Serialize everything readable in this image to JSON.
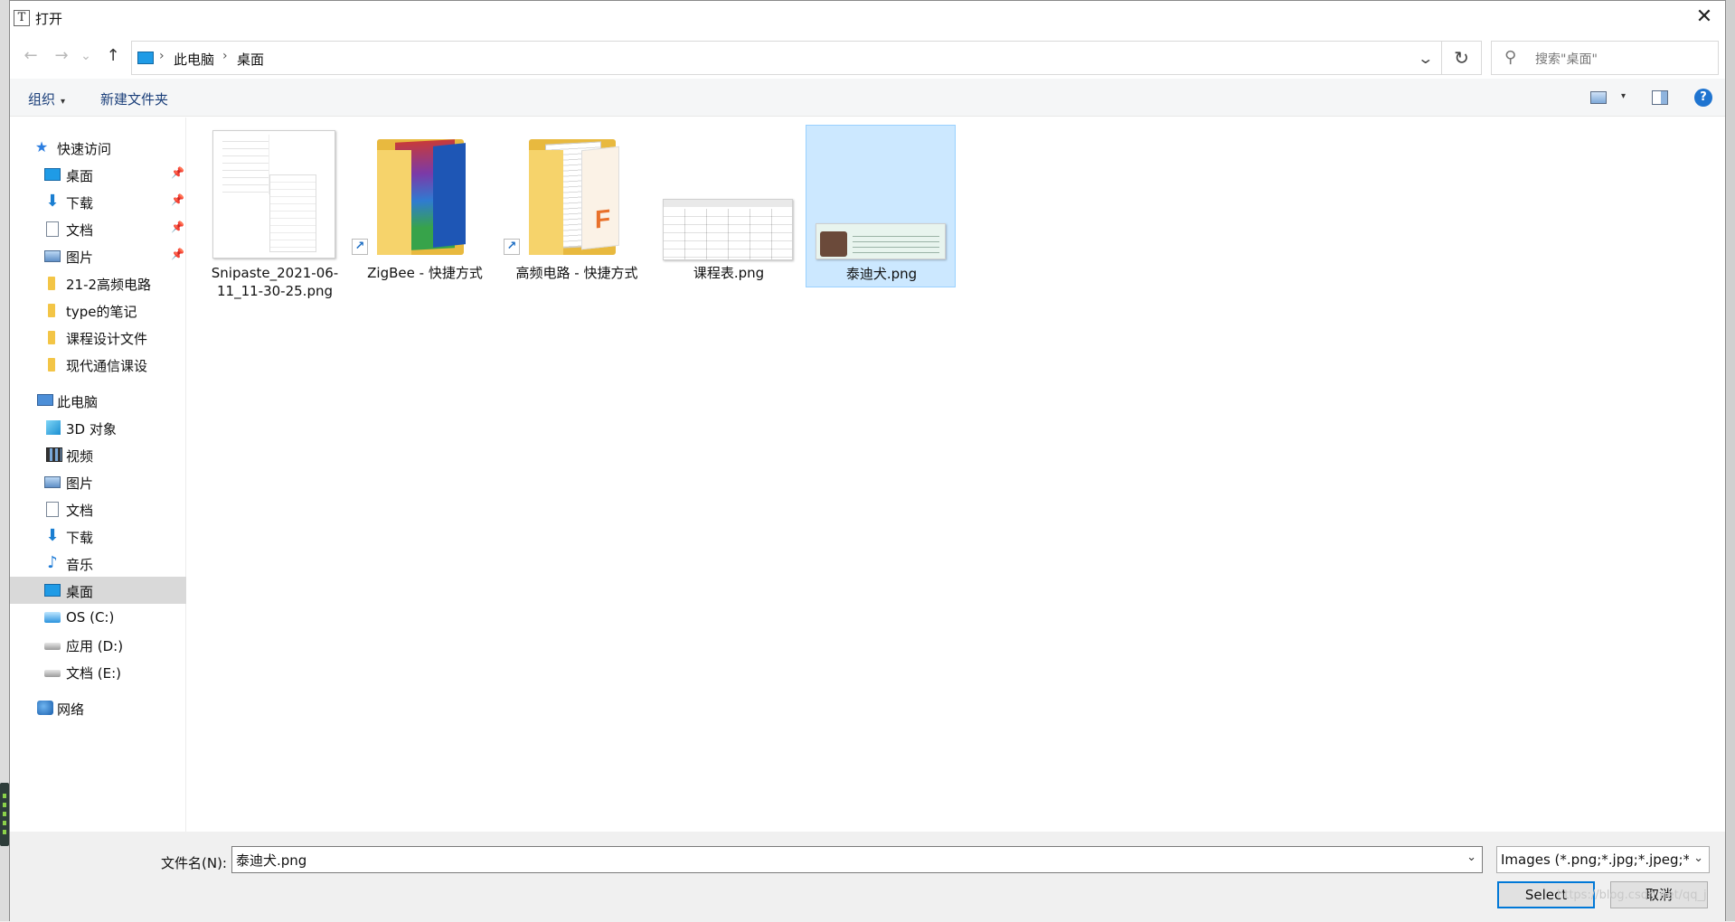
{
  "window": {
    "title": "打开",
    "app_icon_glyph": "T",
    "close_glyph": "✕"
  },
  "nav": {
    "back": "←",
    "forward": "→",
    "recent": "⌄",
    "up": "↑",
    "breadcrumbs": [
      "此电脑",
      "桌面"
    ],
    "sep": "›",
    "dropdown": "⌄",
    "refresh": "↻",
    "search_placeholder": "搜索\"桌面\"",
    "search_icon": "⚲"
  },
  "toolbar": {
    "organize": "组织",
    "organize_caret": "▾",
    "new_folder": "新建文件夹",
    "help": "?",
    "view_caret": "▾"
  },
  "sidebar": {
    "quick_access": "快速访问",
    "quick_items": [
      {
        "label": "桌面",
        "icon": "desktop-icon",
        "pinned": true
      },
      {
        "label": "下载",
        "icon": "download-icon",
        "pinned": true
      },
      {
        "label": "文档",
        "icon": "document-icon",
        "pinned": true
      },
      {
        "label": "图片",
        "icon": "pictures-icon",
        "pinned": true
      },
      {
        "label": "21-2高频电路",
        "icon": "folder-icon",
        "pinned": false
      },
      {
        "label": "type的笔记",
        "icon": "folder-icon",
        "pinned": false
      },
      {
        "label": "课程设计文件",
        "icon": "folder-icon",
        "pinned": false
      },
      {
        "label": "现代通信课设",
        "icon": "folder-icon",
        "pinned": false
      }
    ],
    "this_pc": "此电脑",
    "pc_items": [
      {
        "label": "3D 对象",
        "icon": "3d-objects-icon"
      },
      {
        "label": "视频",
        "icon": "video-icon"
      },
      {
        "label": "图片",
        "icon": "pictures-icon"
      },
      {
        "label": "文档",
        "icon": "document-icon"
      },
      {
        "label": "下载",
        "icon": "download-icon"
      },
      {
        "label": "音乐",
        "icon": "music-icon"
      },
      {
        "label": "桌面",
        "icon": "desktop-icon",
        "selected": true
      },
      {
        "label": "OS (C:)",
        "icon": "os-drive-icon"
      },
      {
        "label": "应用 (D:)",
        "icon": "drive-icon"
      },
      {
        "label": "文档 (E:)",
        "icon": "drive-icon"
      }
    ],
    "network": "网络",
    "pin_glyph": "📌"
  },
  "files": [
    {
      "name": "Snipaste_2021-06-11_11-30-25.png",
      "type": "image"
    },
    {
      "name": "ZigBee - 快捷方式",
      "type": "folder-shortcut"
    },
    {
      "name": "高频电路 - 快捷方式",
      "type": "folder-shortcut"
    },
    {
      "name": "课程表.png",
      "type": "image"
    },
    {
      "name": "泰迪犬.png",
      "type": "image",
      "selected": true
    }
  ],
  "bottom": {
    "filename_label": "文件名(N):",
    "filename_value": "泰迪犬.png",
    "filter_value": "Images (*.png;*.jpg;*.jpeg;*.b",
    "select_label": "Select",
    "cancel_label": "取消",
    "dropdown": "⌄"
  },
  "watermark": "https://blog.csdn.net/qq_j"
}
